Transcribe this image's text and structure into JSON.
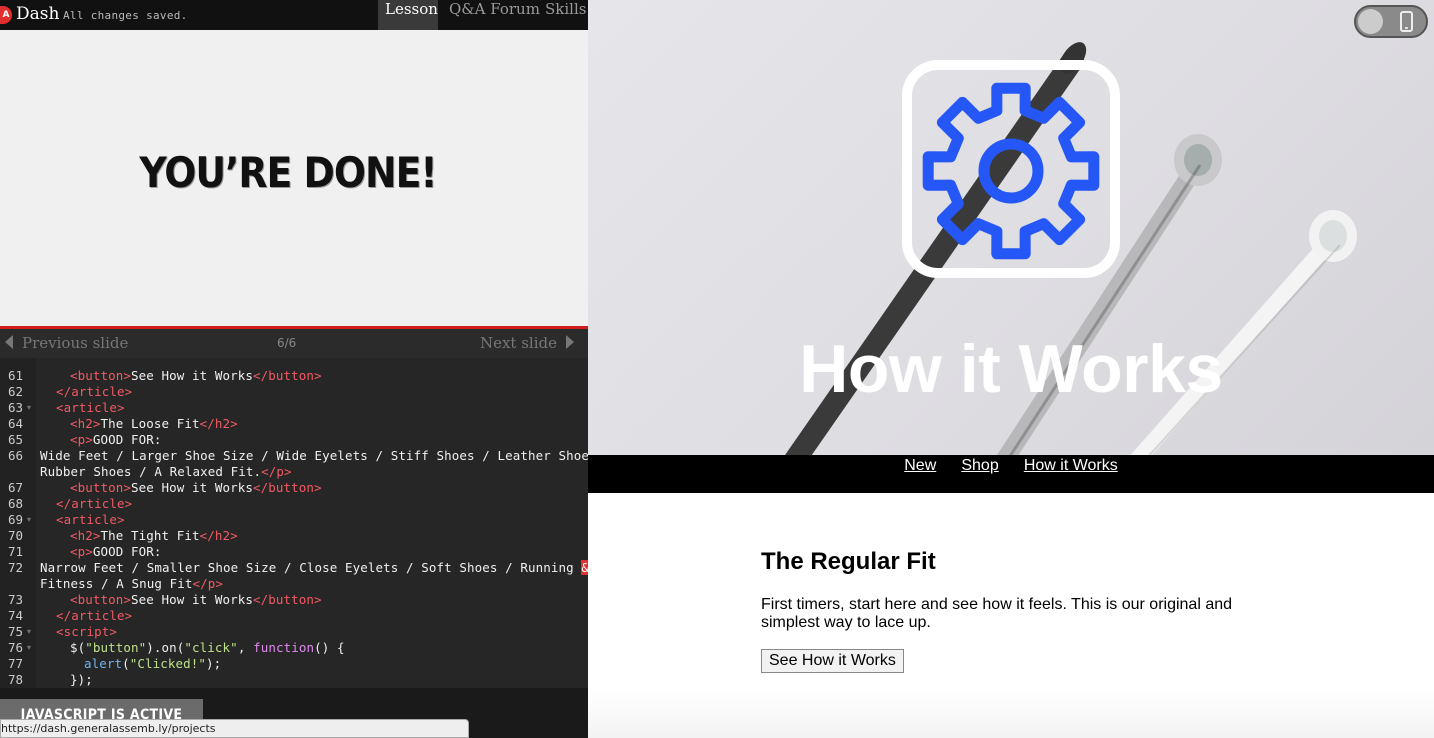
{
  "topbar": {
    "logo_text": "A",
    "app_name": "Dash",
    "save_status": "All changes saved.",
    "tabs": [
      {
        "label": "Lesson"
      },
      {
        "label": "Q&A Forum"
      },
      {
        "label": "Skills"
      }
    ]
  },
  "slide": {
    "title": "YOU’RE DONE!"
  },
  "slide_nav": {
    "prev_label": "Previous slide",
    "count": "6/6",
    "next_label": "Next slide"
  },
  "editor": {
    "line_numbers": [
      "61",
      "62",
      "63",
      "64",
      "65",
      "66",
      "67",
      "68",
      "69",
      "70",
      "71",
      "72",
      "73",
      "74",
      "75",
      "76",
      "77",
      "78"
    ]
  },
  "bottom": {
    "js_status": "JAVASCRIPT IS ACTIVE",
    "status_url": "https://dash.generalassemb.ly/projects"
  },
  "preview": {
    "device_toggle": "phone-icon",
    "hero_icon": "gear-icon",
    "hero_title": "How it Works",
    "nav": [
      {
        "label": "New"
      },
      {
        "label": "Shop"
      },
      {
        "label": "How it Works"
      }
    ],
    "section": {
      "title": "The Regular Fit",
      "body": "First timers, start here and see how it feels. This is our original and simplest way to lace up.",
      "button_label": "See How it Works"
    },
    "accent_color": "#2457f5"
  }
}
